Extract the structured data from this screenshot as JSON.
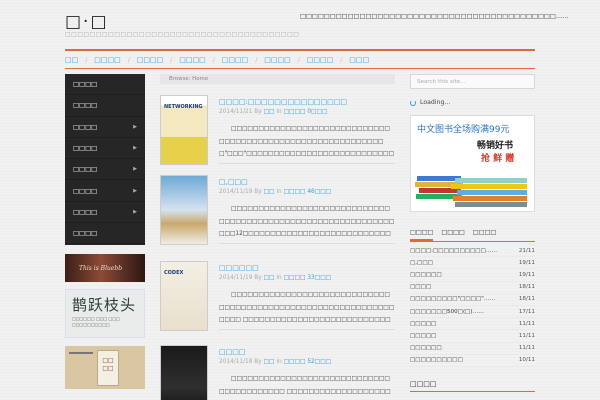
{
  "site": {
    "title": "□·□",
    "description": "□□□□□□□□□□□□□□□□□□□□□□□□□□□□□□□□□□□□□□",
    "quote": "□□□□□□□□□□□□□□□□□□□□□□□□□□□□□□□□□□□□□□□□□□□……"
  },
  "nav": {
    "items": [
      {
        "label": "□□"
      },
      {
        "label": "□□□□"
      },
      {
        "label": "□□□□"
      },
      {
        "label": "□□□□"
      },
      {
        "label": "□□□□"
      },
      {
        "label": "□□□□"
      },
      {
        "label": "□□□□"
      },
      {
        "label": "□□□"
      }
    ]
  },
  "sidebar": {
    "items": [
      {
        "label": "□□□□",
        "has_children": false
      },
      {
        "label": "□□□□",
        "has_children": false
      },
      {
        "label": "□□□□",
        "has_children": true
      },
      {
        "label": "□□□□",
        "has_children": true
      },
      {
        "label": "□□□□",
        "has_children": true
      },
      {
        "label": "□□□□",
        "has_children": true
      },
      {
        "label": "□□□□",
        "has_children": true
      },
      {
        "label": "□□□□",
        "has_children": false
      }
    ]
  },
  "banners": {
    "b1_text": "This is Bluebb",
    "b2_big": "鹊跃枝头",
    "b2_small_1": "□□□□□□ □□□ □□□",
    "b2_small_2": "□□□□□□□□□□",
    "b3_text": "□□\n□□"
  },
  "breadcrumb": {
    "text": "Browse:  Home"
  },
  "posts": [
    {
      "title": "□□□□:□□□□□□□□□□□□□□□",
      "date": "2014/11/21",
      "by": "By",
      "author": "□□",
      "in": "In",
      "category": "□□□□",
      "comments": "0□□□",
      "excerpt": "□□□□□□□□□□□□□□□□□□□□□□□□□□□□□□□□□□□□□□□□□□□□□□□□□□□□□□□□□□□□\"□□□\"□□□□□□□□□□□□□□□□□□□□□□□□□□□□□□□□□□□□□□□□□□……",
      "cover_title": "NETWORKING"
    },
    {
      "title": "□,□□□",
      "date": "2014/11/19",
      "by": "By",
      "author": "□□",
      "in": "In",
      "category": "□□□□",
      "comments": "46□□□",
      "excerpt": "□□□□□□□□□□□□□□□□□□□□□□□□□□□□□□□□□□□□□□□□□□□□□□□□□□□□□□□□□□□□□□□□12□□□□□□□□□□□□□□□□□□□□□□□□□□□□□□□□□□□□□□□□□□□□□……",
      "cover_title": ""
    },
    {
      "title": "□□□□□□",
      "date": "2014/11/19",
      "by": "By",
      "author": "□□",
      "in": "In",
      "category": "□□□□",
      "comments": "33□□□",
      "excerpt": "□□□□□□□□□□□□□□□□□□□□□□□□□□□□□□□□□□□□□□□□□□□□□□□□□□□□□□□□□□□□□□□□□ □□□□□□□□□□□□□□□□□□□□□□□□□□□□□□□□□□□□□□□\"□\"□□……",
      "cover_title": "CODEX"
    },
    {
      "title": "□□□□",
      "date": "2014/11/18",
      "by": "By",
      "author": "□□",
      "in": "In",
      "category": "□□□□",
      "comments": "52□□□",
      "excerpt": "□□□□□□□□□□□□□□□□□□□□□□□□□□□□□□□□□□□□□□□□□ □□□□□□□□□□□□□□□□□□□□□□□□□□□□□□□□□□□□□□……",
      "cover_title": ""
    }
  ],
  "right": {
    "search_placeholder": "Search this site...",
    "loading": "Loading...",
    "ad_h1": "中文图书全场购满99元",
    "ad_h2": "畅销好书",
    "ad_h3": "抢 鲜 赠",
    "tabs": [
      {
        "label": "□□□□",
        "active": true
      },
      {
        "label": "□□□□",
        "active": false
      },
      {
        "label": "□□□□",
        "active": false
      }
    ],
    "recent": [
      {
        "title": "□□□□:□□□□□□□□□□……",
        "date": "21/11"
      },
      {
        "title": "□,□□□",
        "date": "19/11"
      },
      {
        "title": "□□□□□□",
        "date": "19/11"
      },
      {
        "title": "□□□□",
        "date": "18/11"
      },
      {
        "title": "□□□□□□□□□\"□□□□\"……",
        "date": "18/11"
      },
      {
        "title": "□□□□□□□500□(□)……",
        "date": "17/11"
      },
      {
        "title": "□□□□□",
        "date": "11/11"
      },
      {
        "title": "□□□□□",
        "date": "11/11"
      },
      {
        "title": "□□□□□□",
        "date": "11/11"
      },
      {
        "title": "□□□□□□□□□□",
        "date": "10/11"
      }
    ],
    "widget2_title": "□□□□"
  }
}
